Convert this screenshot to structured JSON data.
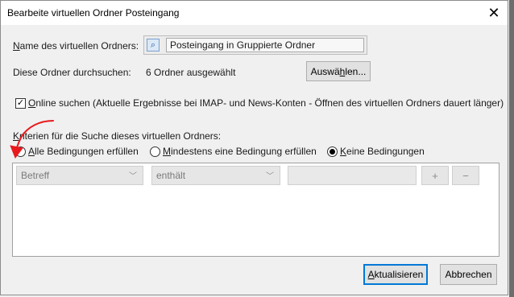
{
  "dialog": {
    "title": "Bearbeite virtuellen Ordner Posteingang",
    "close_glyph": "✕"
  },
  "folder_name": {
    "label_first": "N",
    "label_rest": "ame des virtuellen Ordners:",
    "icon": "search-folder-icon",
    "value": "Posteingang in Gruppierte Ordner"
  },
  "search_folders": {
    "label": "Diese Ordner durchsuchen:",
    "selection": "6 Ordner ausgewählt",
    "choose_button_pre": "Auswä",
    "choose_button_key": "h",
    "choose_button_post": "len..."
  },
  "online_search": {
    "checked": true,
    "check_glyph": "✓",
    "label_key": "O",
    "label_rest": "nline suchen (Aktuelle Ergebnisse bei IMAP- und News-Konten - Öffnen des virtuellen Ordners dauert länger)"
  },
  "criteria": {
    "heading_key": "K",
    "heading_rest": "riterien für die Suche dieses virtuellen Ordners:",
    "options": [
      {
        "key": "A",
        "rest": "lle Bedingungen erfüllen",
        "selected": false
      },
      {
        "key": "M",
        "rest": "indestens eine Bedingung erfüllen",
        "selected": false
      },
      {
        "key": "K",
        "rest": "eine Bedingungen",
        "selected": true
      }
    ]
  },
  "rule": {
    "field": "Betreff",
    "operator": "enthält",
    "value": "",
    "chevron": "﹀",
    "add_label": "+",
    "remove_label": "−"
  },
  "footer": {
    "update_key": "A",
    "update_rest": "ktualisieren",
    "cancel_label": "Abbrechen"
  },
  "colors": {
    "annotation_arrow": "#e8191c",
    "default_button_border": "#0078d7"
  }
}
